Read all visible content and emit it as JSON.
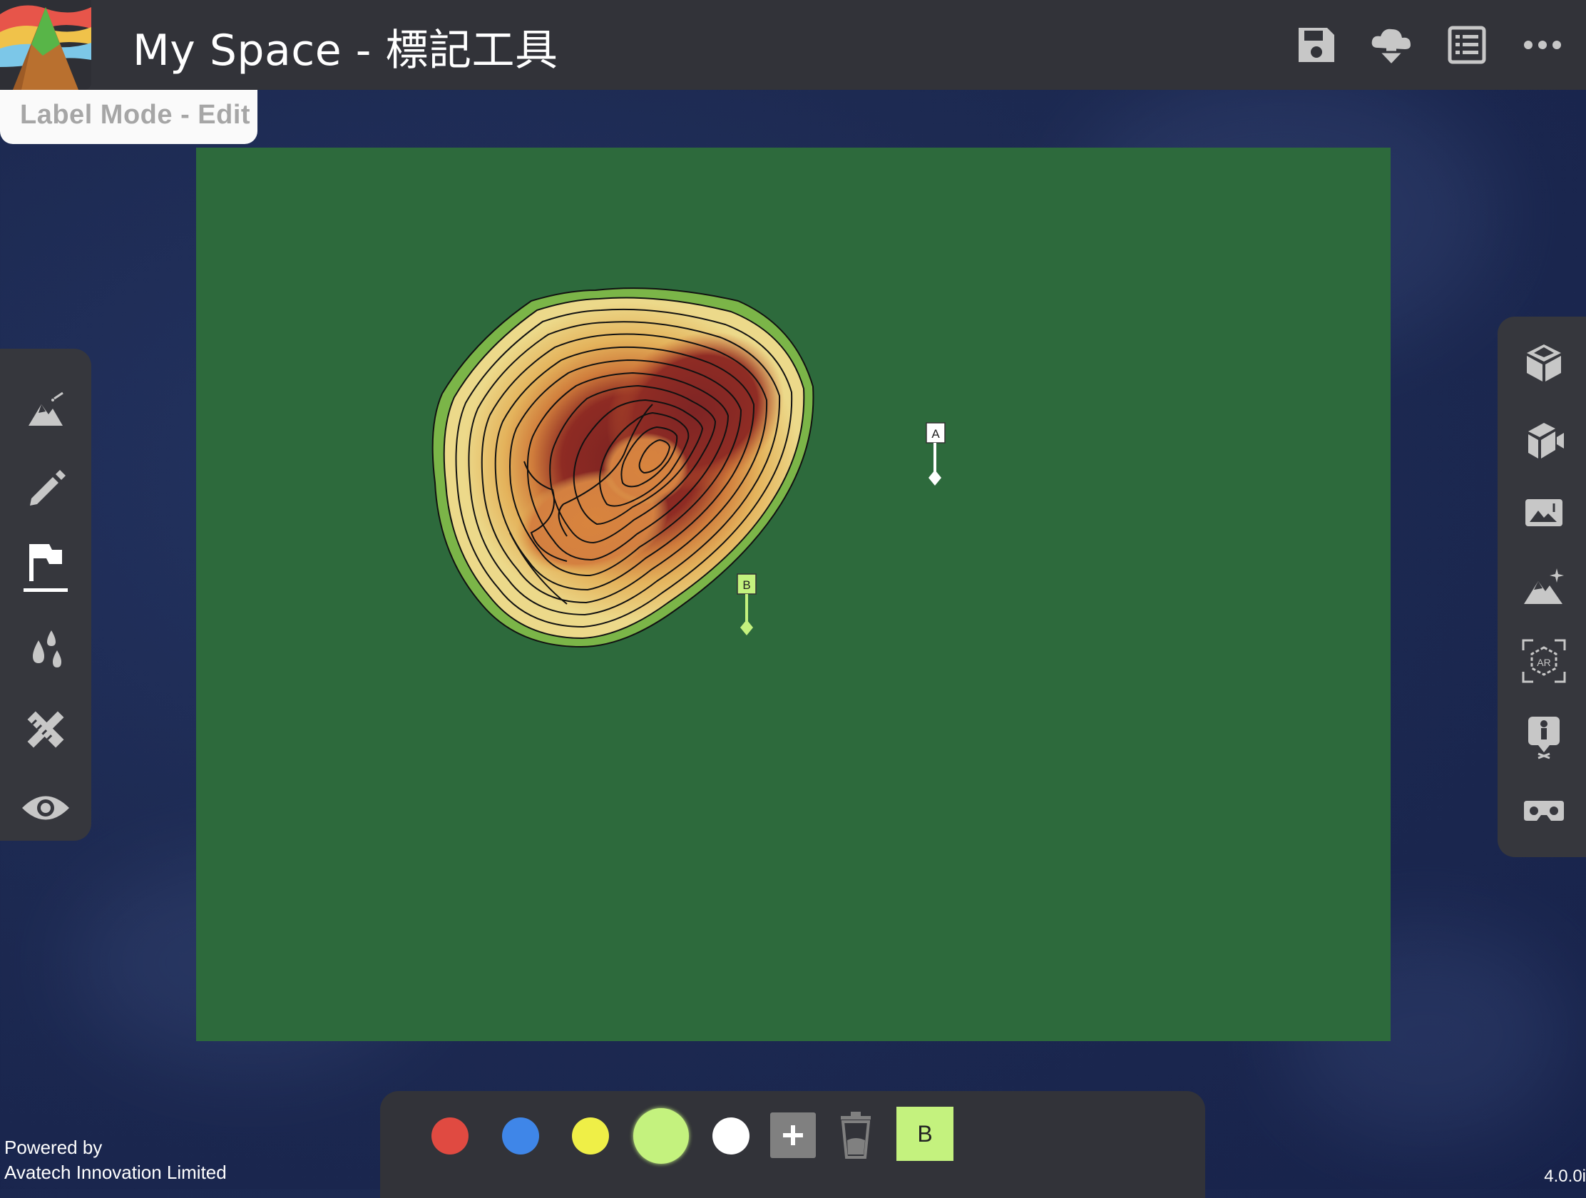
{
  "header": {
    "title": "My Space - 標記工具",
    "icons": [
      "save-icon",
      "download-icon",
      "list-icon",
      "more-icon"
    ]
  },
  "mode_tab": {
    "label": "Label Mode - Edit"
  },
  "left_toolbar": {
    "items": [
      "terrain-edit-icon",
      "pencil-icon",
      "flag-icon",
      "water-icon",
      "ruler-pencil-icon",
      "eye-icon"
    ],
    "active": "flag-icon"
  },
  "right_toolbar": {
    "items": [
      "box-icon",
      "camera-3d-icon",
      "image-map-icon",
      "terrain-magic-icon",
      "ar-icon",
      "person-ar-icon",
      "vr-icon"
    ]
  },
  "map": {
    "markers": [
      {
        "label": "A",
        "color": "#ffffff"
      },
      {
        "label": "B",
        "color": "#c4f27e"
      }
    ]
  },
  "palette": {
    "colors": [
      "#e04a41",
      "#3f86e8",
      "#efef47",
      "#c4f27e",
      "#ffffff"
    ],
    "selected_color": "#c4f27e",
    "active_label": "B"
  },
  "footer": {
    "line1": "Powered by",
    "line2": "Avatech Innovation Limited",
    "version": "4.0.0i"
  }
}
